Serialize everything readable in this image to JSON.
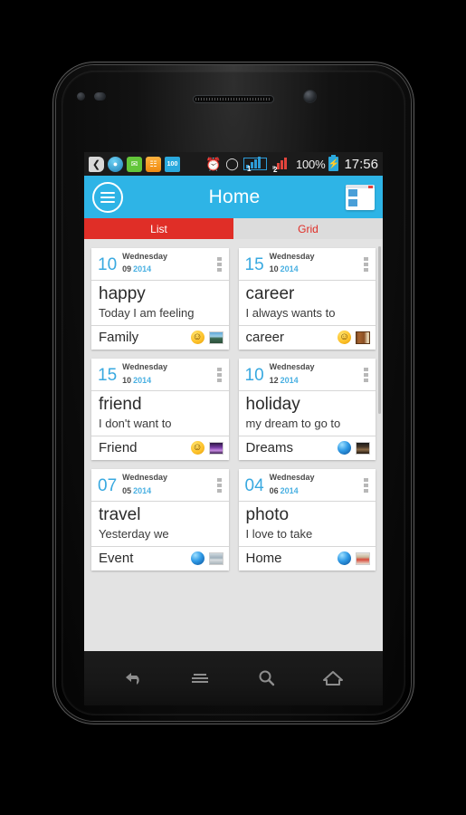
{
  "theme": {
    "appbar_color": "#2eb4e6",
    "tab_active_color": "#e02e27",
    "content_bg": "#e3e3e3",
    "date_accent": "#39a9e0"
  },
  "statusbar": {
    "icons": [
      "back-icon",
      "browser-icon",
      "sms-icon",
      "news-icon",
      "battery-saver-icon"
    ],
    "battery_saver_label": "100",
    "alarm_icon": "⏰",
    "wifi_icon": "◠",
    "sim1_label": "1",
    "sim2_label": "2",
    "battery_percent": "100%",
    "battery_icon": "⚡",
    "time": "17:56"
  },
  "appbar": {
    "menu_icon": "hamburger-icon",
    "title": "Home",
    "layout_icon": "layout-view-icon"
  },
  "tabs": [
    {
      "label": "List",
      "active": true
    },
    {
      "label": "Grid",
      "active": false
    }
  ],
  "cards": [
    {
      "day": "10",
      "weekday": "Wednesday",
      "month": "09",
      "year": "2014",
      "title": "happy",
      "subtitle": "Today I am feeling",
      "category": "Family",
      "mood_icon": "smiley-icon",
      "mood_glyph": "☺",
      "thumb": "th-sunset"
    },
    {
      "day": "15",
      "weekday": "Wednesday",
      "month": "10",
      "year": "2014",
      "title": "career",
      "subtitle": "I always wants to",
      "category": "career",
      "mood_icon": "smiley-icon",
      "mood_glyph": "☺",
      "thumb": "th-book"
    },
    {
      "day": "15",
      "weekday": "Wednesday",
      "month": "10",
      "year": "2014",
      "title": "friend",
      "subtitle": "I don't want to",
      "category": "Friend",
      "mood_icon": "smiley-icon",
      "mood_glyph": "☺",
      "thumb": "th-purple"
    },
    {
      "day": "10",
      "weekday": "Wednesday",
      "month": "12",
      "year": "2014",
      "title": "holiday",
      "subtitle": "my dream to go to",
      "category": "Dreams",
      "mood_icon": "blue-sphere-icon",
      "mood_glyph": "",
      "thumb": "th-dark"
    },
    {
      "day": "07",
      "weekday": "Wednesday",
      "month": "05",
      "year": "2014",
      "title": "travel",
      "subtitle": "Yesterday we",
      "category": "Event",
      "mood_icon": "blue-sphere-icon",
      "mood_glyph": "",
      "thumb": "th-temple"
    },
    {
      "day": "04",
      "weekday": "Wednesday",
      "month": "06",
      "year": "2014",
      "title": "photo",
      "subtitle": "I love to take",
      "category": "Home",
      "mood_icon": "blue-sphere-icon",
      "mood_glyph": "",
      "thumb": "th-people"
    }
  ],
  "navbar": [
    {
      "name": "back-button",
      "icon": "back-arrow-icon"
    },
    {
      "name": "menu-button",
      "icon": "menu-lines-icon"
    },
    {
      "name": "search-button",
      "icon": "search-icon"
    },
    {
      "name": "home-button",
      "icon": "home-icon"
    }
  ]
}
